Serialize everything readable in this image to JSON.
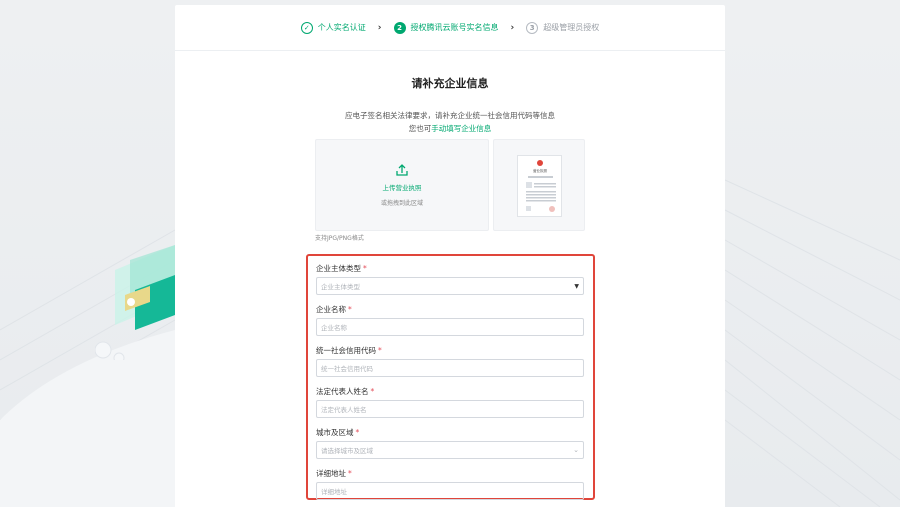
{
  "steps": [
    {
      "label": "个人实名认证",
      "num": "✓",
      "state": "done"
    },
    {
      "label": "授权腾讯云账号实名信息",
      "num": "2",
      "state": "active"
    },
    {
      "label": "超级管理员授权",
      "num": "3",
      "state": "pending"
    }
  ],
  "step_separator": "›",
  "page": {
    "title": "请补充企业信息",
    "desc_line1": "应电子签名相关法律要求，请补充企业统一社会信用代码等信息",
    "desc_line2_prefix": "您也可",
    "desc_line2_link": "手动填写企业信息"
  },
  "upload": {
    "title": "上传营业执照",
    "hint": "或拖拽到此区域",
    "format_note": "支持JPG/PNG格式",
    "sample_heading": "营业执照"
  },
  "form": {
    "entity_type": {
      "label": "企业主体类型",
      "required": "*",
      "placeholder": "企业主体类型"
    },
    "company_name": {
      "label": "企业名称",
      "required": "*",
      "placeholder": "企业名称"
    },
    "credit_code": {
      "label": "统一社会信用代码",
      "required": "*",
      "placeholder": "统一社会信用代码"
    },
    "legal_rep": {
      "label": "法定代表人姓名",
      "required": "*",
      "placeholder": "法定代表人姓名"
    },
    "city_region": {
      "label": "城市及区域",
      "required": "*",
      "placeholder": "请选择城市及区域"
    },
    "address": {
      "label": "详细地址",
      "required": "*",
      "placeholder": "详细地址"
    }
  },
  "colors": {
    "accent": "#00a870",
    "highlight_border": "#e0453a",
    "required": "#e34d59"
  }
}
